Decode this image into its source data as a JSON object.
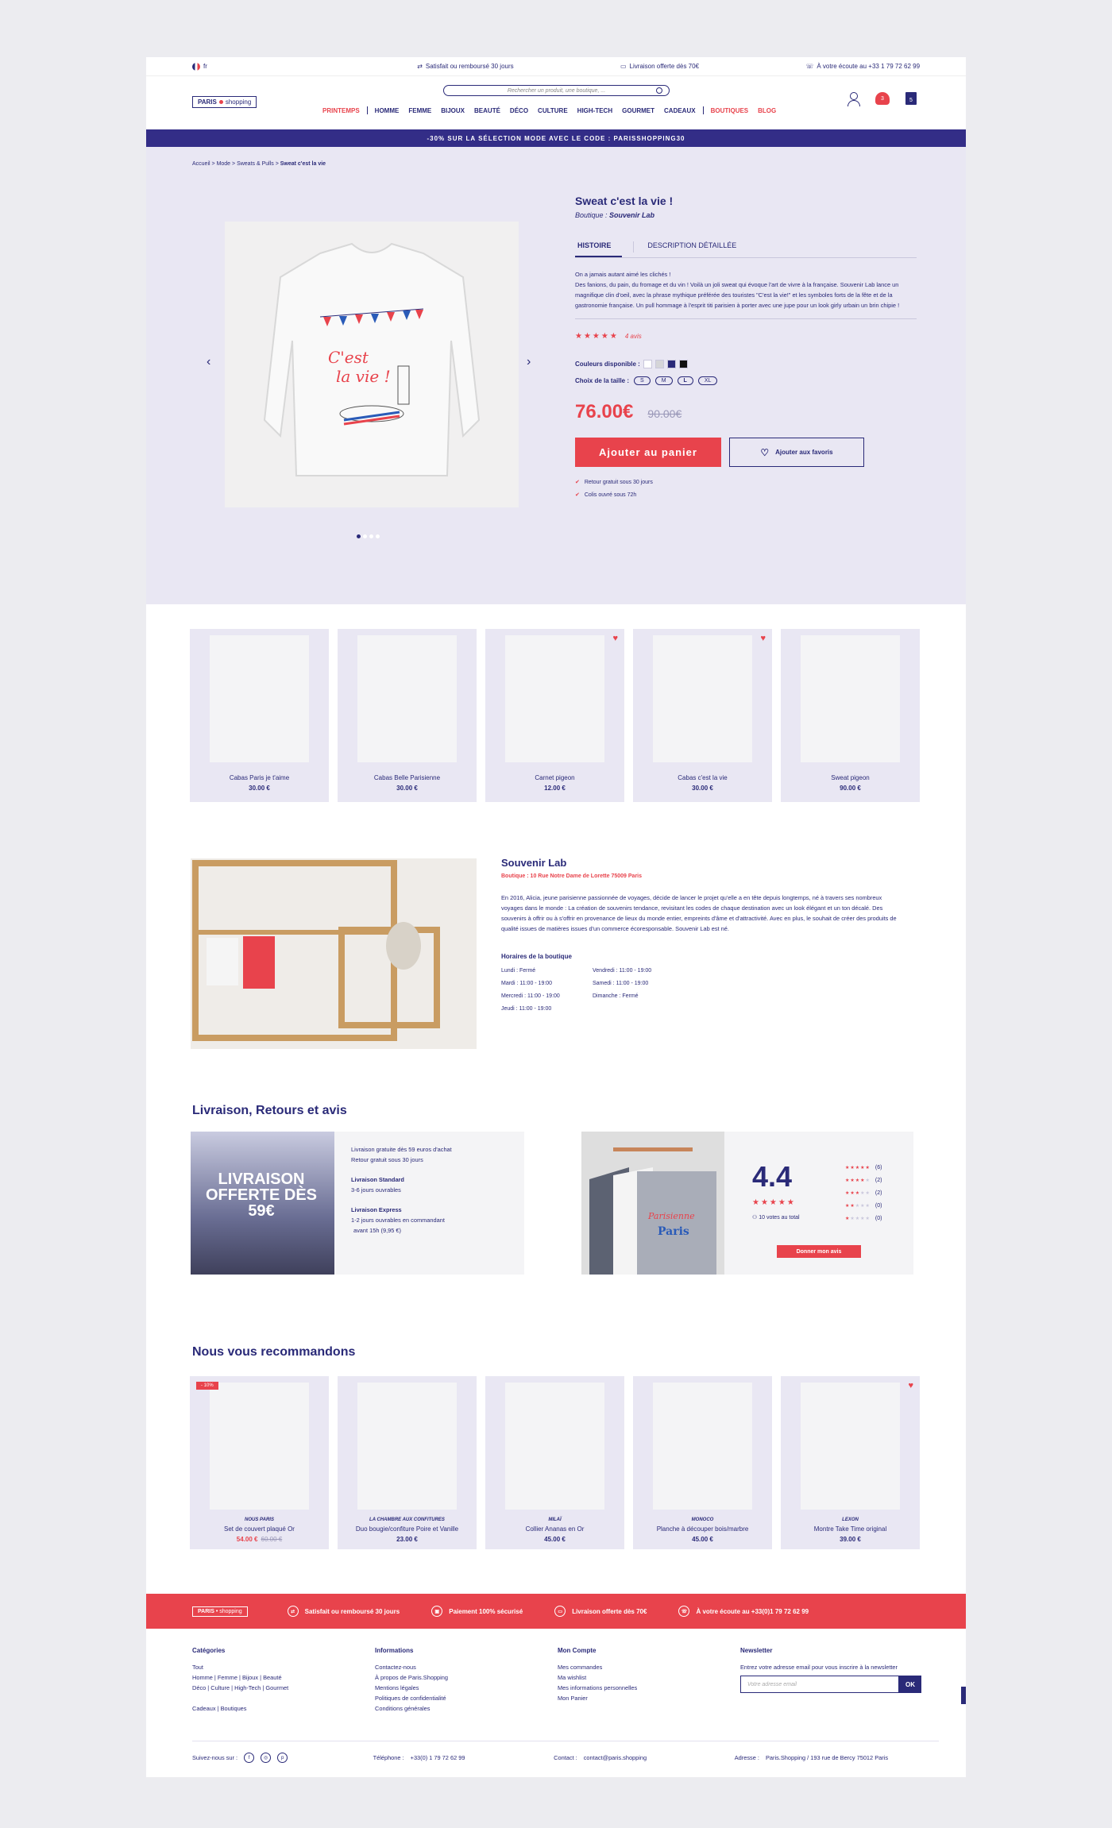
{
  "topbar": {
    "lang": "fr",
    "guarantee": "Satisfait ou remboursé 30 jours",
    "delivery": "Livraison offerte dès 70€",
    "phone": "À votre écoute au +33 1 79 72 62 99"
  },
  "header": {
    "logo_a": "PARIS",
    "logo_b": "shopping",
    "search_placeholder": "Rechercher un produit, une boutique, ...",
    "nav": [
      "PRINTEMPS",
      "HOMME",
      "FEMME",
      "BIJOUX",
      "BEAUTÉ",
      "DÉCO",
      "CULTURE",
      "HIGH-TECH",
      "GOURMET",
      "CADEAUX",
      "BOUTIQUES",
      "BLOG"
    ],
    "fav_count": "3",
    "cart_count": "5"
  },
  "promo": "-30% SUR LA SÉLECTION MODE AVEC LE CODE : PARISSHOPPING30",
  "breadcrumb": [
    "Accueil",
    "Mode",
    "Sweats & Pulls",
    "Sweat c'est la vie"
  ],
  "product": {
    "title": "Sweat c'est la vie !",
    "boutique_label": "Boutique :",
    "boutique_name": "Souvenir Lab",
    "tab_history": "HISTOIRE",
    "tab_desc": "DESCRIPTION DÉTAILLÉE",
    "description": [
      "On a jamais autant aimé les clichés !",
      "Des fanions, du pain, du fromage et du vin ! Voilà un joli sweat qui évoque l'art de vivre à la française. Souvenir Lab lance un magnifique clin d'oeil, avec la phrase mythique préférée des touristes \"C'est la vie!\" et les symboles forts de la fête et de la gastronomie française. Un pull hommage à l'esprit titi parisien à porter avec une jupe pour un look girly urbain un brin chipie !"
    ],
    "rating": 4.5,
    "reviews": "4 avis",
    "colors_label": "Couleurs disponible :",
    "colors": [
      "#ffffff",
      "#d5d5d8",
      "#2a2a78",
      "#111111"
    ],
    "size_label": "Choix de la taille :",
    "sizes": [
      "S",
      "M",
      "L",
      "XL"
    ],
    "selected_size": "L",
    "price": "76.00€",
    "old_price": "90.00€",
    "add_cart": "Ajouter au panier",
    "add_fav": "Ajouter aux favoris",
    "checks": [
      "Retour gratuit sous 30 jours",
      "Colis ouvré sous 72h"
    ]
  },
  "related": [
    {
      "name": "Cabas Paris je t'aime",
      "price": "30.00 €",
      "fav": false
    },
    {
      "name": "Cabas Belle Parisienne",
      "price": "30.00 €",
      "fav": false
    },
    {
      "name": "Carnet pigeon",
      "price": "12.00 €",
      "fav": true
    },
    {
      "name": "Cabas c'est la vie",
      "price": "30.00 €",
      "fav": true
    },
    {
      "name": "Sweat pigeon",
      "price": "90.00 €",
      "fav": false
    }
  ],
  "shop": {
    "name": "Souvenir Lab",
    "address": "Boutique : 10 Rue Notre Dame de Lorette 75009 Paris",
    "text": "En 2016, Alicia, jeune parisienne passionnée de voyages, décide de lancer le projet qu'elle a en tête depuis longtemps, né à travers ses nombreux voyages dans le monde : La création de souvenirs tendance, revisitant les codes de chaque destination avec un look élégant et un ton décalé. Des souvenirs à offrir ou à s'offrir en provenance de lieux du monde entier, empreints d'âme et d'attractivité. Avec en plus, le souhait de créer des produits de qualité issues de matières issues d'un commerce écoresponsable. Souvenir Lab est né.",
    "hours_title": "Horaires de la boutique",
    "hours": [
      "Lundi : Fermé",
      "Vendredi : 11:00 - 19:00",
      "Mardi : 11:00 - 19:00",
      "Samedi : 11:00 - 19:00",
      "Mercredi : 11:00 - 19:00",
      "Dimanche : Fermé",
      "Jeudi : 11:00 - 19:00",
      ""
    ]
  },
  "livraison": {
    "title": "Livraison, Retours et avis",
    "img_text": "LIVRAISON OFFERTE DÈS 59€",
    "line1": "Livraison gratuite dès 59 euros d'achat",
    "line2": "Retour gratuit sous 30 jours",
    "std_title": "Livraison Standard",
    "std_text": "3-6 jours ouvrables",
    "exp_title": "Livraison Express",
    "exp_text1": "1-2 jours ouvrables en commandant",
    "exp_text2": "avant 15h (9,95 €)"
  },
  "reviews": {
    "score": "4.4",
    "votes": "10 votes au total",
    "bars": [
      {
        "stars": 5,
        "count": "(6)"
      },
      {
        "stars": 4,
        "count": "(2)"
      },
      {
        "stars": 3,
        "count": "(2)"
      },
      {
        "stars": 2,
        "count": "(0)"
      },
      {
        "stars": 1,
        "count": "(0)"
      }
    ],
    "button": "Donner mon avis"
  },
  "recommend": {
    "title": "Nous vous recommandons",
    "items": [
      {
        "brand": "NOUS PARIS",
        "name": "Set de couvert plaqué Or",
        "price": "54.00 €",
        "old": "60.00 €",
        "badge": "- 10%",
        "fav": false
      },
      {
        "brand": "LA CHAMBRE AUX CONFITURES",
        "name": "Duo bougie/confiture Poire et Vanille",
        "price": "23.00 €",
        "old": "",
        "badge": "",
        "fav": false
      },
      {
        "brand": "MILAÏ",
        "name": "Collier Ananas en Or",
        "price": "45.00 €",
        "old": "",
        "badge": "",
        "fav": false
      },
      {
        "brand": "MONOCO",
        "name": "Planche à découper bois/marbre",
        "price": "45.00 €",
        "old": "",
        "badge": "",
        "fav": false
      },
      {
        "brand": "LEXON",
        "name": "Montre Take Time original",
        "price": "39.00 €",
        "old": "",
        "badge": "",
        "fav": true
      }
    ]
  },
  "footer_bar": {
    "logo_a": "PARIS",
    "logo_b": "shopping",
    "items": [
      "Satisfait ou remboursé 30 jours",
      "Paiement 100% sécurisé",
      "Livraison offerte dès 70€",
      "À votre écoute au +33(0)1 79 72 62 99"
    ]
  },
  "footer": {
    "col1_title": "Catégories",
    "col1": [
      "Tout",
      "Homme | Femme | Bijoux | Beauté",
      "Déco | Culture | High-Tech | Gourmet",
      "",
      "Cadeaux | Boutiques"
    ],
    "col2_title": "Informations",
    "col2": [
      "Contactez-nous",
      "À propos de Paris.Shopping",
      "Mentions légales",
      "Politiques de confidentialité",
      "Conditions générales"
    ],
    "col3_title": "Mon Compte",
    "col3": [
      "Mes commandes",
      "Ma wishlist",
      "Mes informations personnelles",
      "Mon Panier"
    ],
    "col4_title": "Newsletter",
    "col4_text": "Entrez votre adresse email pour vous inscrire à la newsletter",
    "nl_placeholder": "Votre adresse email",
    "nl_ok": "OK",
    "follow": "Suivez-nous sur :",
    "phone_label": "Téléphone :",
    "phone": "+33(0) 1 79 72 62 99",
    "contact_label": "Contact :",
    "contact": "contact@paris.shopping",
    "addr_label": "Adresse :",
    "addr": "Paris.Shopping  /  193 rue de Bercy 75012 Paris"
  }
}
